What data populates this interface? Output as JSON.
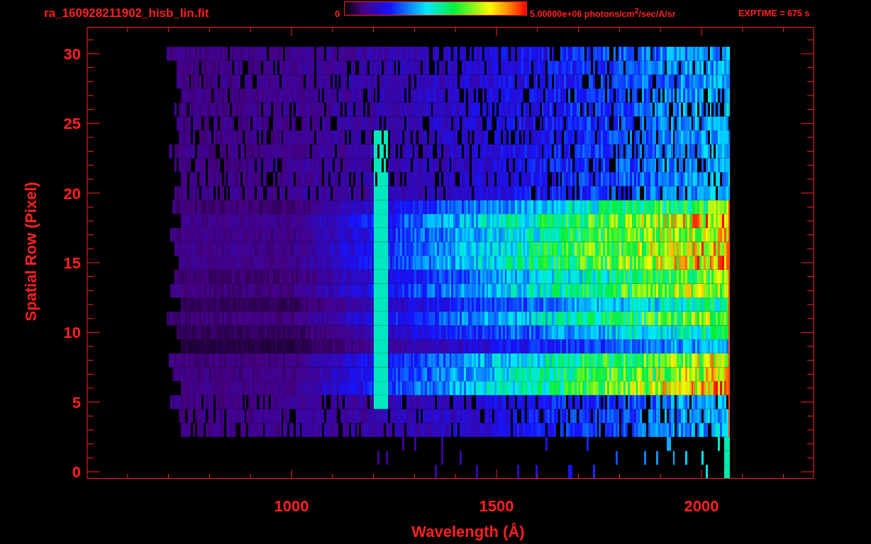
{
  "title": "ra_160928211902_hisb_lin.fit",
  "colorbar": {
    "min_label": "0",
    "max_label": "5.00000e+06 photons/cm$^{2}$/sec/A/sr"
  },
  "exposure": "EXPTIME = 675 s",
  "x_axis": {
    "label": "Wavelength (Å)",
    "ticks": [
      "1000",
      "1500",
      "2000"
    ]
  },
  "y_axis": {
    "label": "Spatial Row (Pixel)",
    "ticks": [
      "30",
      "25",
      "20",
      "15",
      "10",
      "5",
      "0"
    ]
  }
}
